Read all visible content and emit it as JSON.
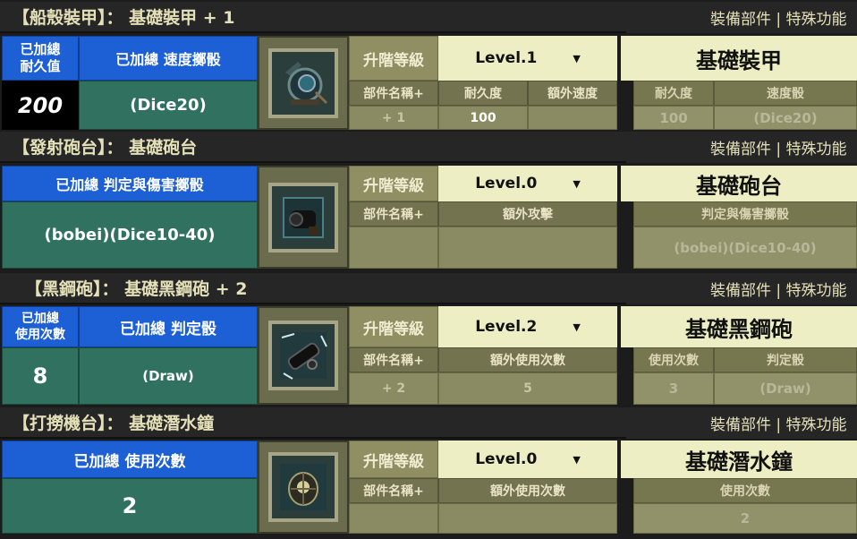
{
  "right_tab": "裝備部件 | 特殊功能",
  "upgrade_label": "升階等級",
  "dropdown_arrow": "▼",
  "sections": [
    {
      "title": "【船殼裝甲】： 基礎裝甲 + 1",
      "left_head_1": "已加總\n耐久值",
      "left_head_2": "已加總  速度擲骰",
      "left_val_1": "200",
      "left_val_2": "(Dice20)",
      "level": "Level.1",
      "part_name": "基礎裝甲",
      "mid_headers": [
        "部件名稱+",
        "耐久度",
        "額外速度"
      ],
      "mid_values": [
        "+ 1",
        "100",
        ""
      ],
      "right_headers": [
        "耐久度",
        "速度骰"
      ],
      "right_values": [
        "100",
        "(Dice20)"
      ],
      "icon": "diving-helmet-icon"
    },
    {
      "title": "【發射砲台】： 基礎砲台",
      "left_head_1": "已加總  判定與傷害擲骰",
      "left_val_1": "(bobei)(Dice10-40)",
      "level": "Level.0",
      "part_name": "基礎砲台",
      "mid_headers": [
        "部件名稱+",
        "額外攻擊"
      ],
      "mid_values": [
        "",
        ""
      ],
      "right_headers": [
        "判定與傷害擲骰"
      ],
      "right_values": [
        "(bobei)(Dice10-40)"
      ],
      "icon": "cannon-turret-icon"
    },
    {
      "title": "【黑鋼砲】： 基礎黑鋼砲 + 2",
      "left_head_1": "已加總\n使用次數",
      "left_head_2": "已加總   判定骰",
      "left_val_1": "8",
      "left_val_2": "(Draw)",
      "level": "Level.2",
      "part_name": "基礎黑鋼砲",
      "mid_headers": [
        "部件名稱+",
        "額外使用次數"
      ],
      "mid_values": [
        "+ 2",
        "5"
      ],
      "right_headers": [
        "使用次數",
        "判定骰"
      ],
      "right_values": [
        "3",
        "(Draw)"
      ],
      "icon": "black-steel-cannon-icon"
    },
    {
      "title": "【打撈機台】： 基礎潛水鐘",
      "left_head_1": "已加總  使用次數",
      "left_val_1": "2",
      "level": "Level.0",
      "part_name": "基礎潛水鐘",
      "mid_headers": [
        "部件名稱+",
        "額外使用次數"
      ],
      "mid_values": [
        "",
        ""
      ],
      "right_headers": [
        "使用次數"
      ],
      "right_values": [
        "2"
      ],
      "icon": "diving-bell-icon"
    }
  ]
}
